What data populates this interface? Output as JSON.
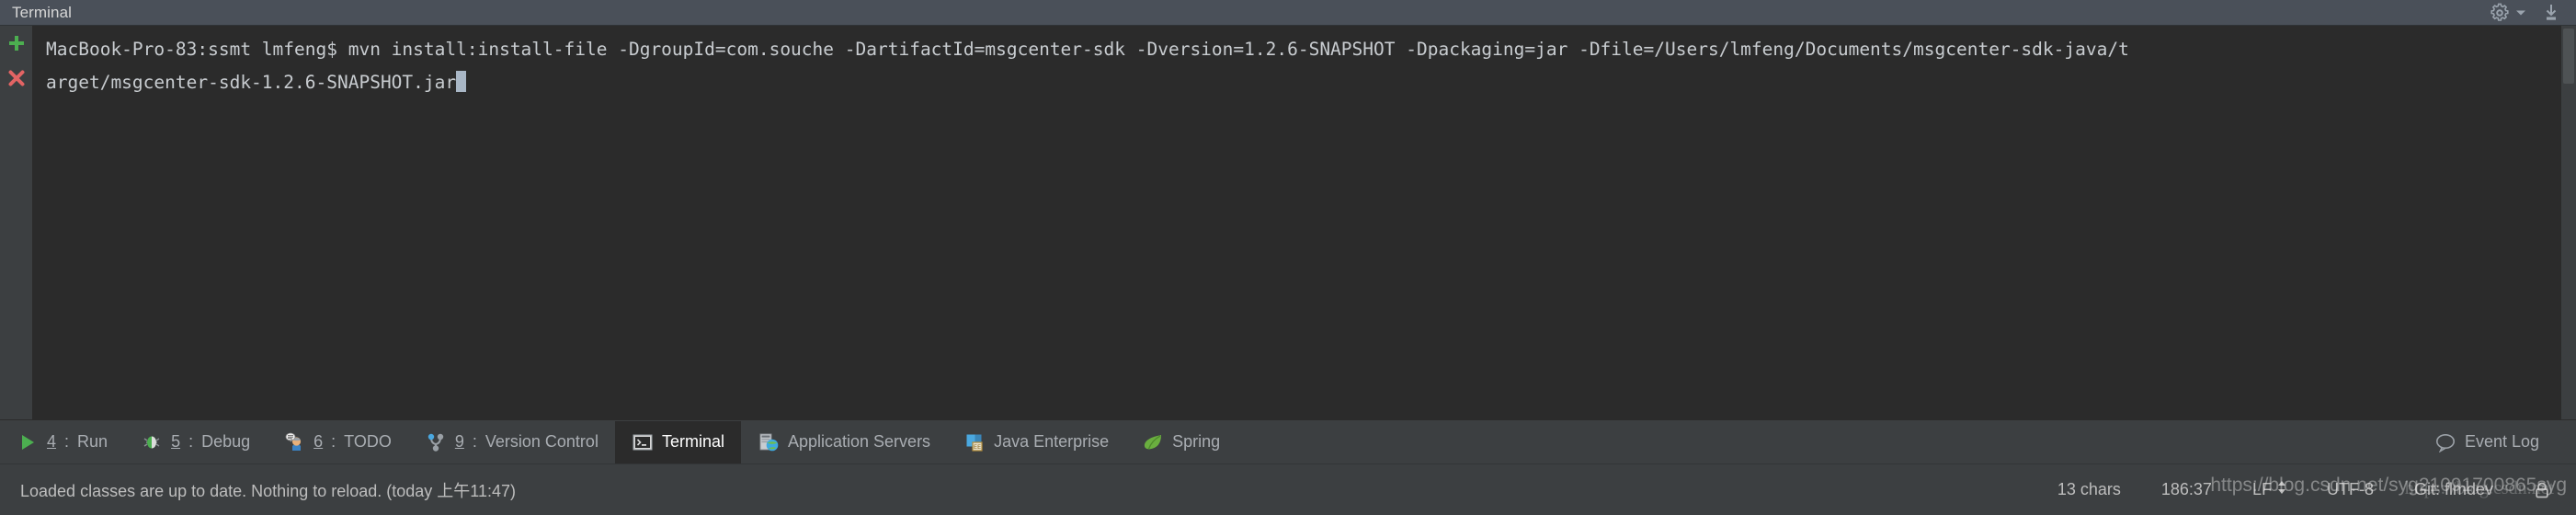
{
  "tool_window": {
    "title": "Terminal",
    "actions": [
      {
        "name": "settings-gear",
        "icon": "gear-icon",
        "label": "Settings"
      },
      {
        "name": "hide-window",
        "icon": "hide-icon",
        "label": "Hide"
      }
    ]
  },
  "gutter": {
    "new_session": {
      "label": "+",
      "color": "#4caf50",
      "icon": "plus-icon"
    },
    "close_session": {
      "label": "×",
      "color": "#e36464",
      "icon": "close-icon"
    }
  },
  "terminal": {
    "line1": "MacBook-Pro-83:ssmt lmfeng$ mvn install:install-file -DgroupId=com.souche -DartifactId=msgcenter-sdk -Dversion=1.2.6-SNAPSHOT -Dpackaging=jar -Dfile=/Users/lmfeng/Documents/msgcenter-sdk-java/t",
    "line2": "arget/msgcenter-sdk-1.2.6-SNAPSHOT.jar",
    "background": "#2b2b2b",
    "foreground": "#c8ccd0"
  },
  "tool_tabs": [
    {
      "num": "4",
      "sep": ": ",
      "label": "Run",
      "icon": "run-icon",
      "active": false
    },
    {
      "num": "5",
      "sep": ": ",
      "label": "Debug",
      "icon": "debug-bug-icon",
      "active": false
    },
    {
      "num": "6",
      "sep": ": ",
      "label": "TODO",
      "icon": "todo-person-icon",
      "active": false
    },
    {
      "num": "9",
      "sep": ": ",
      "label": "Version Control",
      "icon": "branch-icon",
      "active": false
    },
    {
      "num": "",
      "sep": "",
      "label": "Terminal",
      "icon": "terminal-prompt-icon",
      "active": true
    },
    {
      "num": "",
      "sep": "",
      "label": "Application Servers",
      "icon": "app-server-icon",
      "active": false
    },
    {
      "num": "",
      "sep": "",
      "label": "Java Enterprise",
      "icon": "java-ee-icon",
      "active": false
    },
    {
      "num": "",
      "sep": "",
      "label": "Spring",
      "icon": "spring-leaf-icon",
      "active": false
    }
  ],
  "event_log": {
    "label": "Event Log",
    "icon": "speech-bubble-icon"
  },
  "status_bar": {
    "message": "Loaded classes are up to date. Nothing to reload. (today 上午11:47)",
    "chars": "13 chars",
    "caret_position": "186:37",
    "line_separator": "LF",
    "encoding": "UTF-8",
    "branch": "Git: flmdev"
  },
  "watermark": {
    "url": "https://blog.csdn.net/syg21091700865syg",
    "url_alt": "https://blog.csdn.net"
  }
}
